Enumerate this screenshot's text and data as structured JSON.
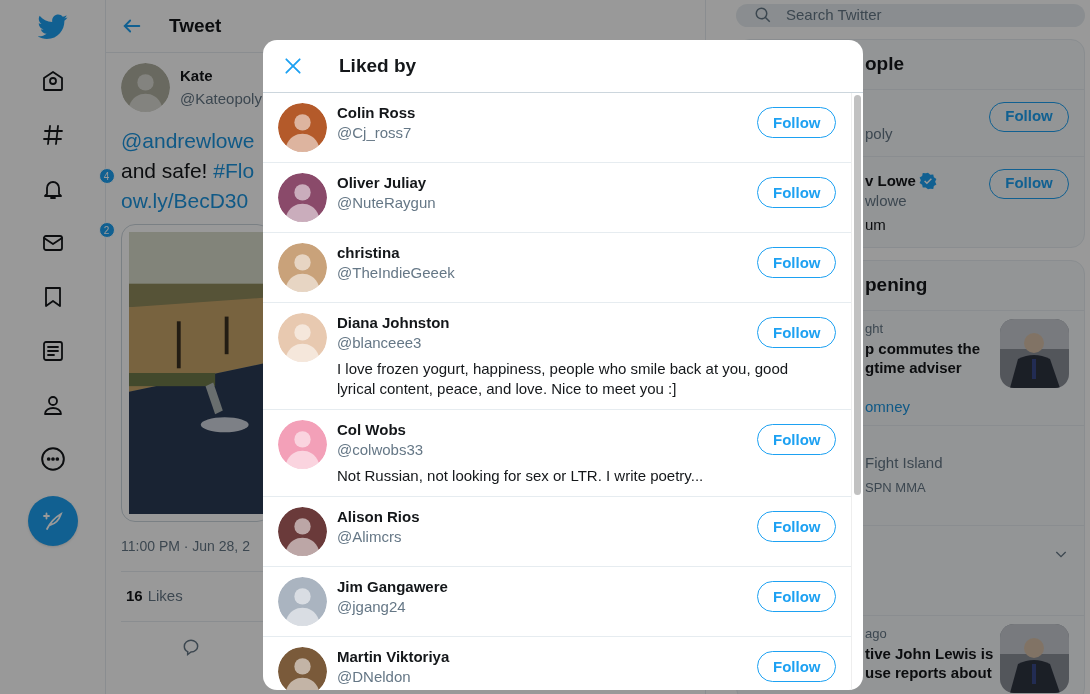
{
  "nav_items": [
    {
      "kind": "logo"
    },
    {
      "kind": "home"
    },
    {
      "kind": "explore"
    },
    {
      "kind": "notifications",
      "badge": "4"
    },
    {
      "kind": "messages",
      "badge": "2"
    },
    {
      "kind": "bookmarks"
    },
    {
      "kind": "lists"
    },
    {
      "kind": "profile"
    },
    {
      "kind": "more"
    },
    {
      "kind": "compose"
    }
  ],
  "header": {
    "title": "Tweet"
  },
  "tweet": {
    "author": "Kate",
    "handle": "@Kateopoly",
    "lines": [
      [
        {
          "text": "@andrewlowe",
          "link": true
        }
      ],
      [
        {
          "text": "and safe! ",
          "link": false
        },
        {
          "text": "#Flo",
          "link": true
        }
      ],
      [
        {
          "text": "ow.ly/BecD30",
          "link": true
        }
      ]
    ],
    "media": {
      "kind": "picture"
    },
    "timestamp": "11:00 PM · Jun 28, 2",
    "likes_count": "16",
    "likes_label": "Likes"
  },
  "search": {
    "placeholder": "Search Twitter"
  },
  "who_to_follow": {
    "title": "ople",
    "people": [
      {
        "handle": "poly",
        "button": "Follow"
      },
      {
        "name": "v Lowe",
        "verified": true,
        "handle": "wlowe",
        "bio": "um",
        "button": "Follow"
      }
    ]
  },
  "happening": {
    "title": "pening",
    "items": [
      {
        "kind": "story",
        "meta": "ght",
        "lines": [
          "p commutes the",
          "gtime adviser"
        ],
        "link": "omney"
      },
      {
        "kind": "event",
        "lines": [
          "Fight Island"
        ],
        "meta": "SPN MMA"
      },
      {
        "kind": "collapsed"
      },
      {
        "kind": "story",
        "meta": "ago",
        "lines": [
          "tive John Lewis is",
          "use reports about"
        ]
      }
    ]
  },
  "modal": {
    "title": "Liked by",
    "users": [
      {
        "name": "Colin Ross",
        "handle": "@Cj_ross7",
        "button": "Follow"
      },
      {
        "name": "Oliver Juliay",
        "handle": "@NuteRaygun",
        "button": "Follow"
      },
      {
        "name": "christina",
        "handle": "@TheIndieGeeek",
        "button": "Follow"
      },
      {
        "name": "Diana Johnston",
        "handle": "@blanceee3",
        "bio": "I love frozen yogurt, happiness, people who smile back at you, good lyrical content, peace, and love. Nice to meet you :]",
        "button": "Follow"
      },
      {
        "name": "Col Wobs",
        "handle": "@colwobs33",
        "bio": "Not Russian, not looking for sex or LTR. I write poetry...",
        "button": "Follow"
      },
      {
        "name": "Alison Rios",
        "handle": "@Alimcrs",
        "button": "Follow"
      },
      {
        "name": "Jim Gangawere",
        "handle": "@jgang24",
        "button": "Follow"
      },
      {
        "name": "Martin Viktoriya",
        "handle": "@DNeldon",
        "button": "Follow"
      }
    ]
  }
}
